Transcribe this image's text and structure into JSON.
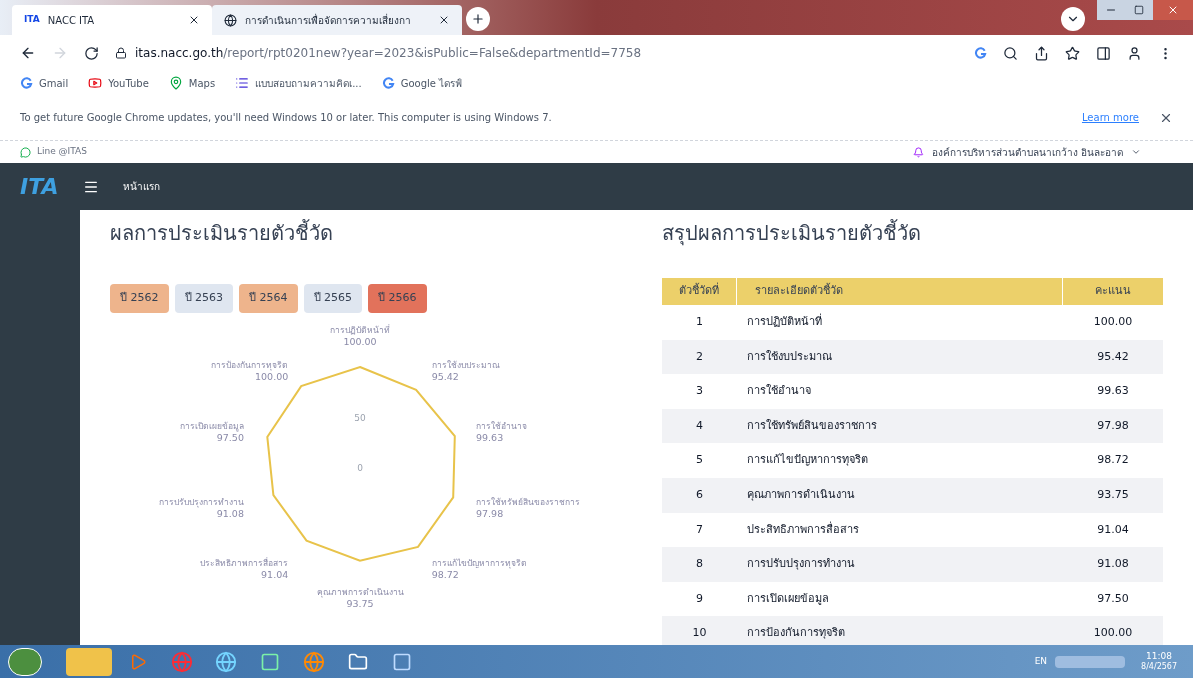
{
  "browser": {
    "tabs": [
      {
        "title": "NACC ITA",
        "icon_text": "ITA",
        "selected": true
      },
      {
        "title": "การดำเนินการเพื่อจัดการความเสี่ยงกา",
        "selected": false
      }
    ],
    "url_host": "itas.nacc.go.th",
    "url_path": "/report/rpt0201new?year=2023&isPublic=False&departmentId=7758",
    "bookmarks": [
      "Gmail",
      "YouTube",
      "Maps",
      "แบบสอบถามความคิดเ...",
      "Google ไดรฟ์"
    ],
    "banner": {
      "text": "To get future Google Chrome updates, you'll need Windows 10 or later. This computer is using Windows 7.",
      "link": "Learn more"
    }
  },
  "site": {
    "line_link": "Line @ITAS",
    "org": "องค์การบริหารส่วนตำบลนาเกว้าง อินละอาด",
    "logo": "ITA",
    "nav": "หน้าแรก"
  },
  "left": {
    "title": "ผลการประเมินรายตัวชี้วัด",
    "years": [
      {
        "label": "ปี 2562",
        "color": "#eeb48c"
      },
      {
        "label": "ปี 2563",
        "color": "#dfe6f0"
      },
      {
        "label": "ปี 2564",
        "color": "#eeb48c"
      },
      {
        "label": "ปี 2565",
        "color": "#dfe6f0"
      },
      {
        "label": "ปี 2566",
        "color": "#e2725b"
      }
    ],
    "radar": {
      "ticks": [
        "50",
        "0"
      ],
      "axes": [
        {
          "label": "การปฏิบัติหน้าที่",
          "value": "100.00"
        },
        {
          "label": "การป้องกันการทุจริต",
          "value": "100.00"
        },
        {
          "label": "การใช้งบประมาณ",
          "value": "95.42"
        },
        {
          "label": "การเปิดเผยข้อมูล",
          "value": "97.50"
        },
        {
          "label": "การใช้อำนาจ",
          "value": "99.63"
        },
        {
          "label": "การปรับปรุงการทำงาน",
          "value": "91.08"
        },
        {
          "label": "การใช้ทรัพย์สินของราชการ",
          "value": "97.98"
        },
        {
          "label": "ประสิทธิภาพการสื่อสาร",
          "value": "91.04"
        },
        {
          "label": "การแก้ไขปัญหาการทุจริต",
          "value": "98.72"
        },
        {
          "label": "คุณภาพการดำเนินงาน",
          "value": "93.75"
        }
      ]
    }
  },
  "right": {
    "title": "สรุปผลการประเมินรายตัวชี้วัด",
    "columns": [
      "ตัวชี้วัดที่",
      "รายละเอียดตัวชี้วัด",
      "คะแนน"
    ],
    "rows": [
      [
        "1",
        "การปฏิบัติหน้าที่",
        "100.00"
      ],
      [
        "2",
        "การใช้งบประมาณ",
        "95.42"
      ],
      [
        "3",
        "การใช้อำนาจ",
        "99.63"
      ],
      [
        "4",
        "การใช้ทรัพย์สินของราชการ",
        "97.98"
      ],
      [
        "5",
        "การแก้ไขปัญหาการทุจริต",
        "98.72"
      ],
      [
        "6",
        "คุณภาพการดำเนินงาน",
        "93.75"
      ],
      [
        "7",
        "ประสิทธิภาพการสื่อสาร",
        "91.04"
      ],
      [
        "8",
        "การปรับปรุงการทำงาน",
        "91.08"
      ],
      [
        "9",
        "การเปิดเผยข้อมูล",
        "97.50"
      ],
      [
        "10",
        "การป้องกันการทุจริต",
        "100.00"
      ]
    ]
  },
  "taskbar": {
    "lang": "EN",
    "time": "11:08",
    "date": "8/4/2567"
  }
}
